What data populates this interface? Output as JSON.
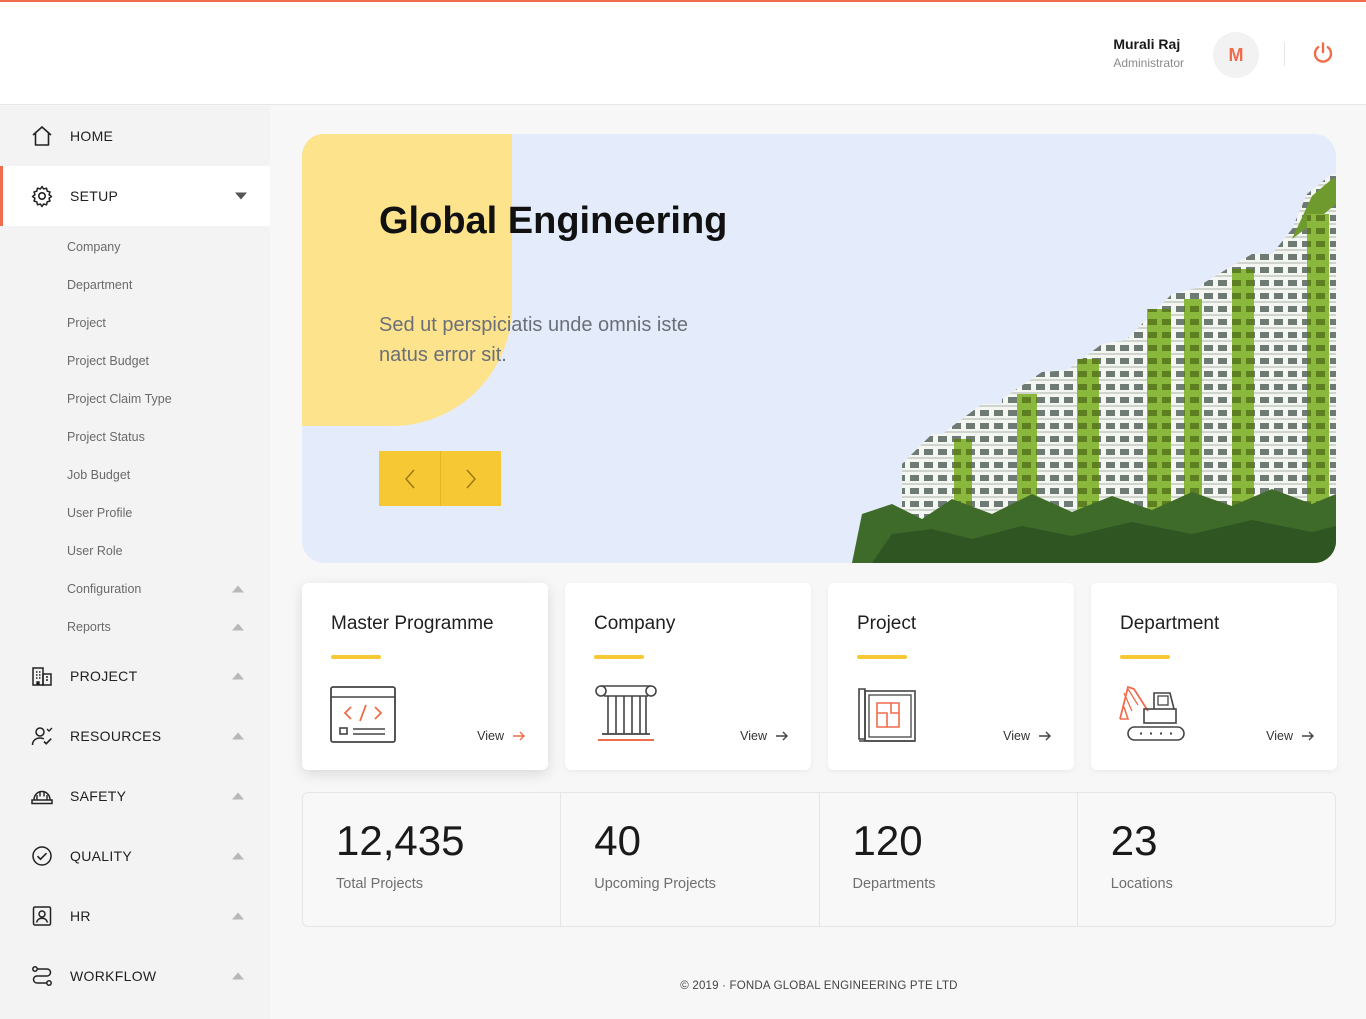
{
  "header": {
    "user_name": "Murali Raj",
    "user_role": "Administrator",
    "avatar_initial": "M",
    "power_icon": "power-icon",
    "accent_color": "#ef6c4d"
  },
  "sidebar": {
    "home": {
      "label": "HOME",
      "icon": "home-icon"
    },
    "setup": {
      "label": "SETUP",
      "icon": "gear-icon",
      "expanded": true,
      "children": [
        {
          "label": "Company"
        },
        {
          "label": "Department"
        },
        {
          "label": "Project"
        },
        {
          "label": "Project Budget"
        },
        {
          "label": "Project Claim Type"
        },
        {
          "label": "Project Status"
        },
        {
          "label": "Job Budget"
        },
        {
          "label": "User Profile"
        },
        {
          "label": "User Role"
        },
        {
          "label": "Configuration",
          "has_children": true
        },
        {
          "label": "Reports",
          "has_children": true
        }
      ]
    },
    "sections": [
      {
        "label": "PROJECT",
        "icon": "building-icon"
      },
      {
        "label": "RESOURCES",
        "icon": "user-check-icon"
      },
      {
        "label": "SAFETY",
        "icon": "hard-hat-icon"
      },
      {
        "label": "QUALITY",
        "icon": "check-circle-icon"
      },
      {
        "label": "HR",
        "icon": "id-badge-icon"
      },
      {
        "label": "WORKFLOW",
        "icon": "workflow-icon"
      }
    ]
  },
  "hero": {
    "title": "Global Engineering",
    "subtitle": "Sed ut perspiciatis unde omnis iste natus error sit.",
    "prev_icon": "chevron-left-icon",
    "next_icon": "chevron-right-icon",
    "highlight_color": "#f6c833"
  },
  "cards": [
    {
      "title": "Master Programme",
      "view_label": "View",
      "icon": "code-window-icon"
    },
    {
      "title": "Company",
      "view_label": "View",
      "icon": "pillar-icon"
    },
    {
      "title": "Project",
      "view_label": "View",
      "icon": "blueprint-icon"
    },
    {
      "title": "Department",
      "view_label": "View",
      "icon": "excavator-icon"
    }
  ],
  "stats": [
    {
      "value": "12,435",
      "label": "Total Projects"
    },
    {
      "value": "40",
      "label": "Upcoming Projects"
    },
    {
      "value": "120",
      "label": "Departments"
    },
    {
      "value": "23",
      "label": "Locations"
    }
  ],
  "footer": {
    "text": "© 2019 · FONDA GLOBAL ENGINEERING PTE LTD"
  }
}
